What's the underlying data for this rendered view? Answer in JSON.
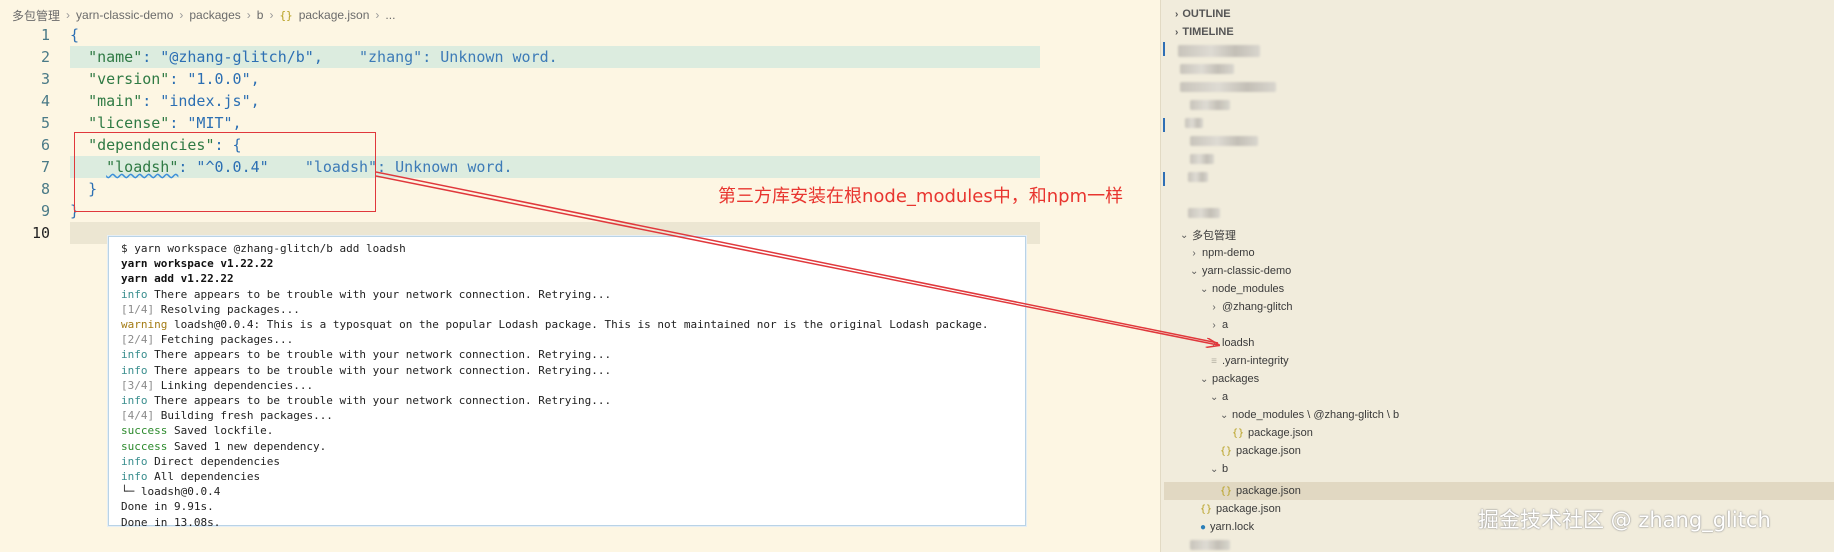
{
  "breadcrumb": {
    "items": [
      "多包管理",
      "yarn-classic-demo",
      "packages",
      "b",
      "package.json",
      "..."
    ],
    "file_icon": "{}"
  },
  "editor": {
    "lines": [
      {
        "num": "1",
        "code": "{"
      },
      {
        "num": "2",
        "key": "\"name\"",
        "rest": ": \"@zhang-glitch/b\",",
        "warning": "\"zhang\": Unknown word."
      },
      {
        "num": "3",
        "key": "\"version\"",
        "rest": ": \"1.0.0\","
      },
      {
        "num": "4",
        "key": "\"main\"",
        "rest": ": \"index.js\","
      },
      {
        "num": "5",
        "key": "\"license\"",
        "rest": ": \"MIT\","
      },
      {
        "num": "6",
        "key": "\"dependencies\"",
        "rest": ": {"
      },
      {
        "num": "7",
        "key": "\"loadsh\"",
        "rest": ": \"^0.0.4\"",
        "warning": "\"loadsh\": Unknown word."
      },
      {
        "num": "8",
        "code": "}"
      },
      {
        "num": "9",
        "code": "}"
      },
      {
        "num": "10",
        "code": ""
      }
    ]
  },
  "annotation": {
    "text": "第三方库安装在根node_modules中，和npm一样",
    "color": "#e8352f"
  },
  "terminal": {
    "lines": [
      {
        "text": "$ yarn workspace @zhang-glitch/b add loadsh",
        "style": "cmd"
      },
      {
        "text": "yarn workspace v1.22.22",
        "style": "bold"
      },
      {
        "text": "yarn add v1.22.22",
        "style": "bold"
      },
      {
        "tag": "info",
        "text": " There appears to be trouble with your network connection. Retrying...",
        "style": "info"
      },
      {
        "tag": "[1/4]",
        "text": " Resolving packages...",
        "style": "step"
      },
      {
        "tag": "warning",
        "text": " loadsh@0.0.4: This is a typosquat on the popular Lodash package. This is not maintained nor is the original Lodash package.",
        "style": "warn"
      },
      {
        "tag": "[2/4]",
        "text": " Fetching packages...",
        "style": "step"
      },
      {
        "tag": "info",
        "text": " There appears to be trouble with your network connection. Retrying...",
        "style": "info"
      },
      {
        "tag": "info",
        "text": " There appears to be trouble with your network connection. Retrying...",
        "style": "info"
      },
      {
        "tag": "[3/4]",
        "text": " Linking dependencies...",
        "style": "step"
      },
      {
        "tag": "info",
        "text": " There appears to be trouble with your network connection. Retrying...",
        "style": "info"
      },
      {
        "tag": "[4/4]",
        "text": " Building fresh packages...",
        "style": "step"
      },
      {
        "tag": "success",
        "text": " Saved lockfile.",
        "style": "succ"
      },
      {
        "tag": "success",
        "text": " Saved 1 new dependency.",
        "style": "succ"
      },
      {
        "tag": "info",
        "text": " Direct dependencies",
        "style": "info"
      },
      {
        "tag": "info",
        "text": " All dependencies",
        "style": "info"
      },
      {
        "text": "└─ loadsh@0.0.4",
        "style": "plain"
      },
      {
        "text": "Done in 9.91s.",
        "style": "plain"
      },
      {
        "text": "Done in 13.08s.",
        "style": "plain"
      }
    ]
  },
  "sidebar": {
    "outline_label": "OUTLINE",
    "timeline_label": "TIMELINE",
    "tree": [
      {
        "label": "多包管理",
        "chevron": "open",
        "icon": ""
      },
      {
        "label": "npm-demo",
        "chevron": "closed",
        "icon": ""
      },
      {
        "label": "yarn-classic-demo",
        "chevron": "open",
        "icon": ""
      },
      {
        "label": "node_modules",
        "chevron": "open",
        "icon": ""
      },
      {
        "label": "@zhang-glitch",
        "chevron": "closed",
        "icon": ""
      },
      {
        "label": "a",
        "chevron": "closed",
        "icon": ""
      },
      {
        "label": "loadsh",
        "chevron": "closed",
        "icon": ""
      },
      {
        "label": ".yarn-integrity",
        "chevron": "none",
        "icon": "integrity"
      },
      {
        "label": "packages",
        "chevron": "open",
        "icon": ""
      },
      {
        "label": "a",
        "chevron": "open",
        "icon": ""
      },
      {
        "label": "node_modules \\ @zhang-glitch \\ b",
        "chevron": "open",
        "icon": ""
      },
      {
        "label": "package.json",
        "chevron": "none",
        "icon": "json"
      },
      {
        "label": "package.json",
        "chevron": "none",
        "icon": "json"
      },
      {
        "label": "b",
        "chevron": "open",
        "icon": ""
      },
      {
        "label": "package.json",
        "chevron": "none",
        "icon": "json",
        "selected": true
      },
      {
        "label": "package.json",
        "chevron": "none",
        "icon": "json"
      },
      {
        "label": "yarn.lock",
        "chevron": "none",
        "icon": "yarn"
      }
    ]
  },
  "watermark": "掘金技术社区 @ zhang_glitch"
}
